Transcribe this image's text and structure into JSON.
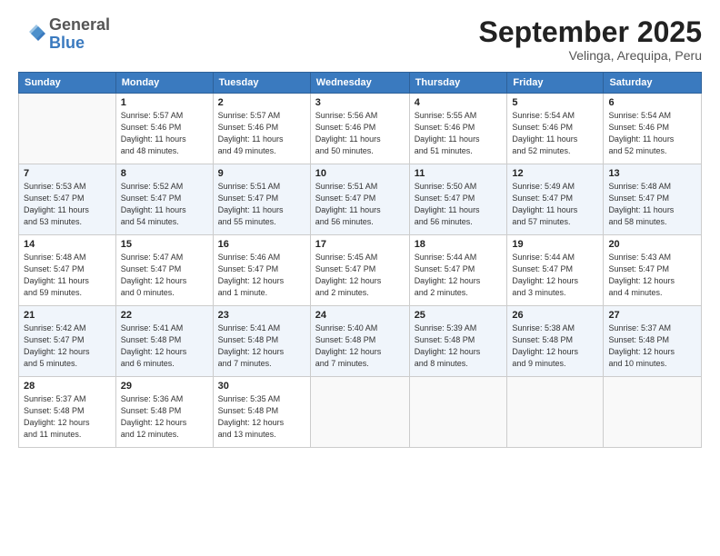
{
  "header": {
    "logo_general": "General",
    "logo_blue": "Blue",
    "month_title": "September 2025",
    "location": "Velinga, Arequipa, Peru"
  },
  "columns": [
    "Sunday",
    "Monday",
    "Tuesday",
    "Wednesday",
    "Thursday",
    "Friday",
    "Saturday"
  ],
  "weeks": [
    [
      {
        "day": "",
        "info": ""
      },
      {
        "day": "1",
        "info": "Sunrise: 5:57 AM\nSunset: 5:46 PM\nDaylight: 11 hours\nand 48 minutes."
      },
      {
        "day": "2",
        "info": "Sunrise: 5:57 AM\nSunset: 5:46 PM\nDaylight: 11 hours\nand 49 minutes."
      },
      {
        "day": "3",
        "info": "Sunrise: 5:56 AM\nSunset: 5:46 PM\nDaylight: 11 hours\nand 50 minutes."
      },
      {
        "day": "4",
        "info": "Sunrise: 5:55 AM\nSunset: 5:46 PM\nDaylight: 11 hours\nand 51 minutes."
      },
      {
        "day": "5",
        "info": "Sunrise: 5:54 AM\nSunset: 5:46 PM\nDaylight: 11 hours\nand 52 minutes."
      },
      {
        "day": "6",
        "info": "Sunrise: 5:54 AM\nSunset: 5:46 PM\nDaylight: 11 hours\nand 52 minutes."
      }
    ],
    [
      {
        "day": "7",
        "info": "Sunrise: 5:53 AM\nSunset: 5:47 PM\nDaylight: 11 hours\nand 53 minutes."
      },
      {
        "day": "8",
        "info": "Sunrise: 5:52 AM\nSunset: 5:47 PM\nDaylight: 11 hours\nand 54 minutes."
      },
      {
        "day": "9",
        "info": "Sunrise: 5:51 AM\nSunset: 5:47 PM\nDaylight: 11 hours\nand 55 minutes."
      },
      {
        "day": "10",
        "info": "Sunrise: 5:51 AM\nSunset: 5:47 PM\nDaylight: 11 hours\nand 56 minutes."
      },
      {
        "day": "11",
        "info": "Sunrise: 5:50 AM\nSunset: 5:47 PM\nDaylight: 11 hours\nand 56 minutes."
      },
      {
        "day": "12",
        "info": "Sunrise: 5:49 AM\nSunset: 5:47 PM\nDaylight: 11 hours\nand 57 minutes."
      },
      {
        "day": "13",
        "info": "Sunrise: 5:48 AM\nSunset: 5:47 PM\nDaylight: 11 hours\nand 58 minutes."
      }
    ],
    [
      {
        "day": "14",
        "info": "Sunrise: 5:48 AM\nSunset: 5:47 PM\nDaylight: 11 hours\nand 59 minutes."
      },
      {
        "day": "15",
        "info": "Sunrise: 5:47 AM\nSunset: 5:47 PM\nDaylight: 12 hours\nand 0 minutes."
      },
      {
        "day": "16",
        "info": "Sunrise: 5:46 AM\nSunset: 5:47 PM\nDaylight: 12 hours\nand 1 minute."
      },
      {
        "day": "17",
        "info": "Sunrise: 5:45 AM\nSunset: 5:47 PM\nDaylight: 12 hours\nand 2 minutes."
      },
      {
        "day": "18",
        "info": "Sunrise: 5:44 AM\nSunset: 5:47 PM\nDaylight: 12 hours\nand 2 minutes."
      },
      {
        "day": "19",
        "info": "Sunrise: 5:44 AM\nSunset: 5:47 PM\nDaylight: 12 hours\nand 3 minutes."
      },
      {
        "day": "20",
        "info": "Sunrise: 5:43 AM\nSunset: 5:47 PM\nDaylight: 12 hours\nand 4 minutes."
      }
    ],
    [
      {
        "day": "21",
        "info": "Sunrise: 5:42 AM\nSunset: 5:47 PM\nDaylight: 12 hours\nand 5 minutes."
      },
      {
        "day": "22",
        "info": "Sunrise: 5:41 AM\nSunset: 5:48 PM\nDaylight: 12 hours\nand 6 minutes."
      },
      {
        "day": "23",
        "info": "Sunrise: 5:41 AM\nSunset: 5:48 PM\nDaylight: 12 hours\nand 7 minutes."
      },
      {
        "day": "24",
        "info": "Sunrise: 5:40 AM\nSunset: 5:48 PM\nDaylight: 12 hours\nand 7 minutes."
      },
      {
        "day": "25",
        "info": "Sunrise: 5:39 AM\nSunset: 5:48 PM\nDaylight: 12 hours\nand 8 minutes."
      },
      {
        "day": "26",
        "info": "Sunrise: 5:38 AM\nSunset: 5:48 PM\nDaylight: 12 hours\nand 9 minutes."
      },
      {
        "day": "27",
        "info": "Sunrise: 5:37 AM\nSunset: 5:48 PM\nDaylight: 12 hours\nand 10 minutes."
      }
    ],
    [
      {
        "day": "28",
        "info": "Sunrise: 5:37 AM\nSunset: 5:48 PM\nDaylight: 12 hours\nand 11 minutes."
      },
      {
        "day": "29",
        "info": "Sunrise: 5:36 AM\nSunset: 5:48 PM\nDaylight: 12 hours\nand 12 minutes."
      },
      {
        "day": "30",
        "info": "Sunrise: 5:35 AM\nSunset: 5:48 PM\nDaylight: 12 hours\nand 13 minutes."
      },
      {
        "day": "",
        "info": ""
      },
      {
        "day": "",
        "info": ""
      },
      {
        "day": "",
        "info": ""
      },
      {
        "day": "",
        "info": ""
      }
    ]
  ]
}
